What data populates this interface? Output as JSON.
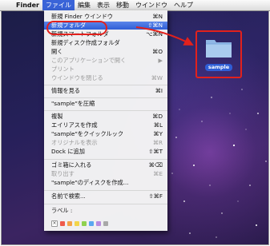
{
  "menubar": {
    "apple_icon": "apple-icon",
    "items": [
      "Finder",
      "ファイル",
      "編集",
      "表示",
      "移動",
      "ウインドウ",
      "ヘルプ"
    ]
  },
  "file_menu": {
    "new_finder_window": {
      "label": "新規 Finder ウインドウ",
      "shortcut": "⌘N"
    },
    "new_folder": {
      "label": "新規フォルダ",
      "shortcut": "⇧⌘N"
    },
    "new_smart_folder": {
      "label": "新規スマートフォルダ",
      "shortcut": "⌥⌘N"
    },
    "new_burn_folder": {
      "label": "新規ディスク作成フォルダ"
    },
    "open": {
      "label": "開く",
      "shortcut": "⌘O"
    },
    "open_with": {
      "label": "このアプリケーションで開く"
    },
    "print": {
      "label": "プリント"
    },
    "close_window": {
      "label": "ウインドウを閉じる",
      "shortcut": "⌘W"
    },
    "get_info": {
      "label": "情報を見る",
      "shortcut": "⌘I"
    },
    "compress": {
      "label": "\"sample\"を圧縮"
    },
    "duplicate": {
      "label": "複製",
      "shortcut": "⌘D"
    },
    "make_alias": {
      "label": "エイリアスを作成",
      "shortcut": "⌘L"
    },
    "quick_look": {
      "label": "\"sample\"をクイックルック",
      "shortcut": "⌘Y"
    },
    "show_original": {
      "label": "オリジナルを表示",
      "shortcut": "⌘R"
    },
    "add_to_dock": {
      "label": "Dock に追加",
      "shortcut": "⇧⌘T"
    },
    "move_to_trash": {
      "label": "ゴミ箱に入れる",
      "shortcut": "⌘⌫"
    },
    "eject": {
      "label": "取り出す",
      "shortcut": "⌘E"
    },
    "burn": {
      "label": "\"sample\"のディスクを作成..."
    },
    "find_by_name": {
      "label": "名前で検索...",
      "shortcut": "⇧⌘F"
    },
    "label_title": "ラベル :",
    "label_colors": [
      "#ef5a4b",
      "#f4a24a",
      "#f3d54a",
      "#8fd14f",
      "#5aa7f0",
      "#b98be0",
      "#a8a8a8"
    ]
  },
  "desktop": {
    "folder_name": "sample"
  },
  "colors": {
    "highlight": "#2f5ed6",
    "annotation_red": "#e2211c"
  }
}
